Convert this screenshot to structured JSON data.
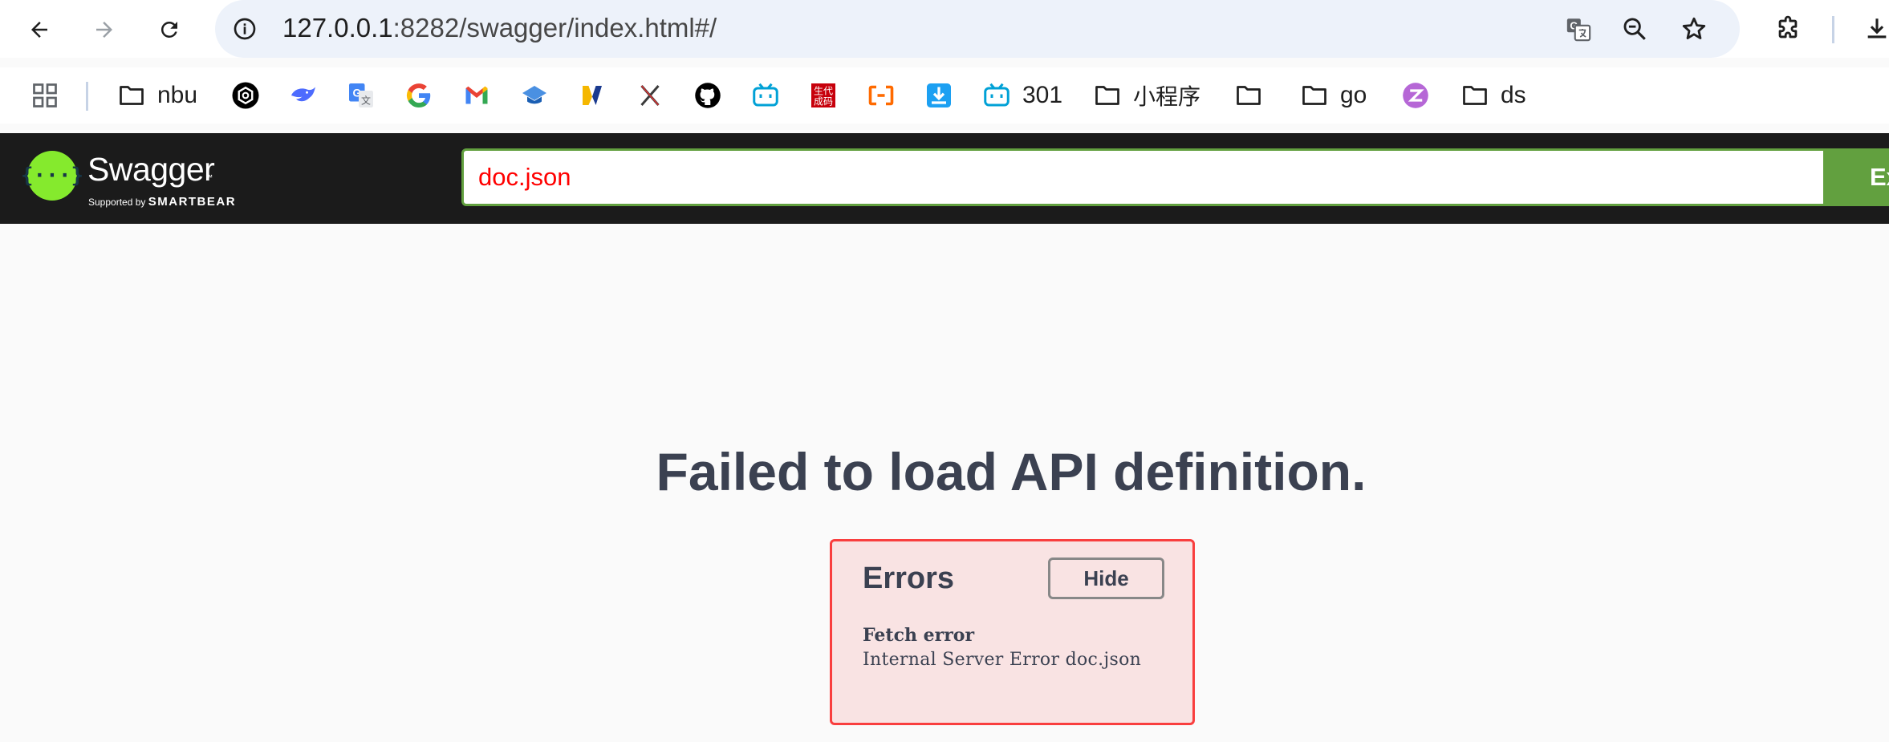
{
  "browser": {
    "url_host": "127.0.0.1",
    "url_rest": ":8282/swagger/index.html#/"
  },
  "bookmarks": [
    {
      "label": "nbu",
      "icon": "folder-icon"
    },
    {
      "label": "",
      "icon": "openai-icon"
    },
    {
      "label": "",
      "icon": "deepseek-icon"
    },
    {
      "label": "",
      "icon": "google-translate-icon"
    },
    {
      "label": "",
      "icon": "google-icon"
    },
    {
      "label": "",
      "icon": "gmail-icon"
    },
    {
      "label": "",
      "icon": "graduation-cap-icon"
    },
    {
      "label": "",
      "icon": "yellow-blue-logo-icon"
    },
    {
      "label": "",
      "icon": "x-mark-icon"
    },
    {
      "label": "",
      "icon": "github-icon"
    },
    {
      "label": "",
      "icon": "bilibili-icon"
    },
    {
      "label": "",
      "icon": "stamp-icon"
    },
    {
      "label": "",
      "icon": "aliyun-icon"
    },
    {
      "label": "",
      "icon": "download-box-icon"
    },
    {
      "label": "301",
      "icon": "bilibili-icon"
    },
    {
      "label": "小程序",
      "icon": "folder-icon"
    },
    {
      "label": "",
      "icon": "folder-icon"
    },
    {
      "label": "go",
      "icon": "folder-icon"
    },
    {
      "label": "",
      "icon": "zhihu-like-icon"
    },
    {
      "label": "ds",
      "icon": "folder-icon"
    }
  ],
  "stamp_text": "生代\n成码",
  "swagger": {
    "brand": "Swagger",
    "trademark": "™",
    "supported_prefix": "Supported by",
    "supported_brand": "SMARTBEAR",
    "spec_url": "doc.json",
    "explore_label": "Explore"
  },
  "main": {
    "title": "Failed to load API definition.",
    "errors_title": "Errors",
    "hide_label": "Hide",
    "error_type": "Fetch error",
    "error_message": "Internal Server Error doc.json"
  },
  "colors": {
    "swagger_green": "#62a03f",
    "logo_green": "#85ea2d",
    "error_red": "#f93e3e",
    "text_dark": "#3b4151"
  }
}
